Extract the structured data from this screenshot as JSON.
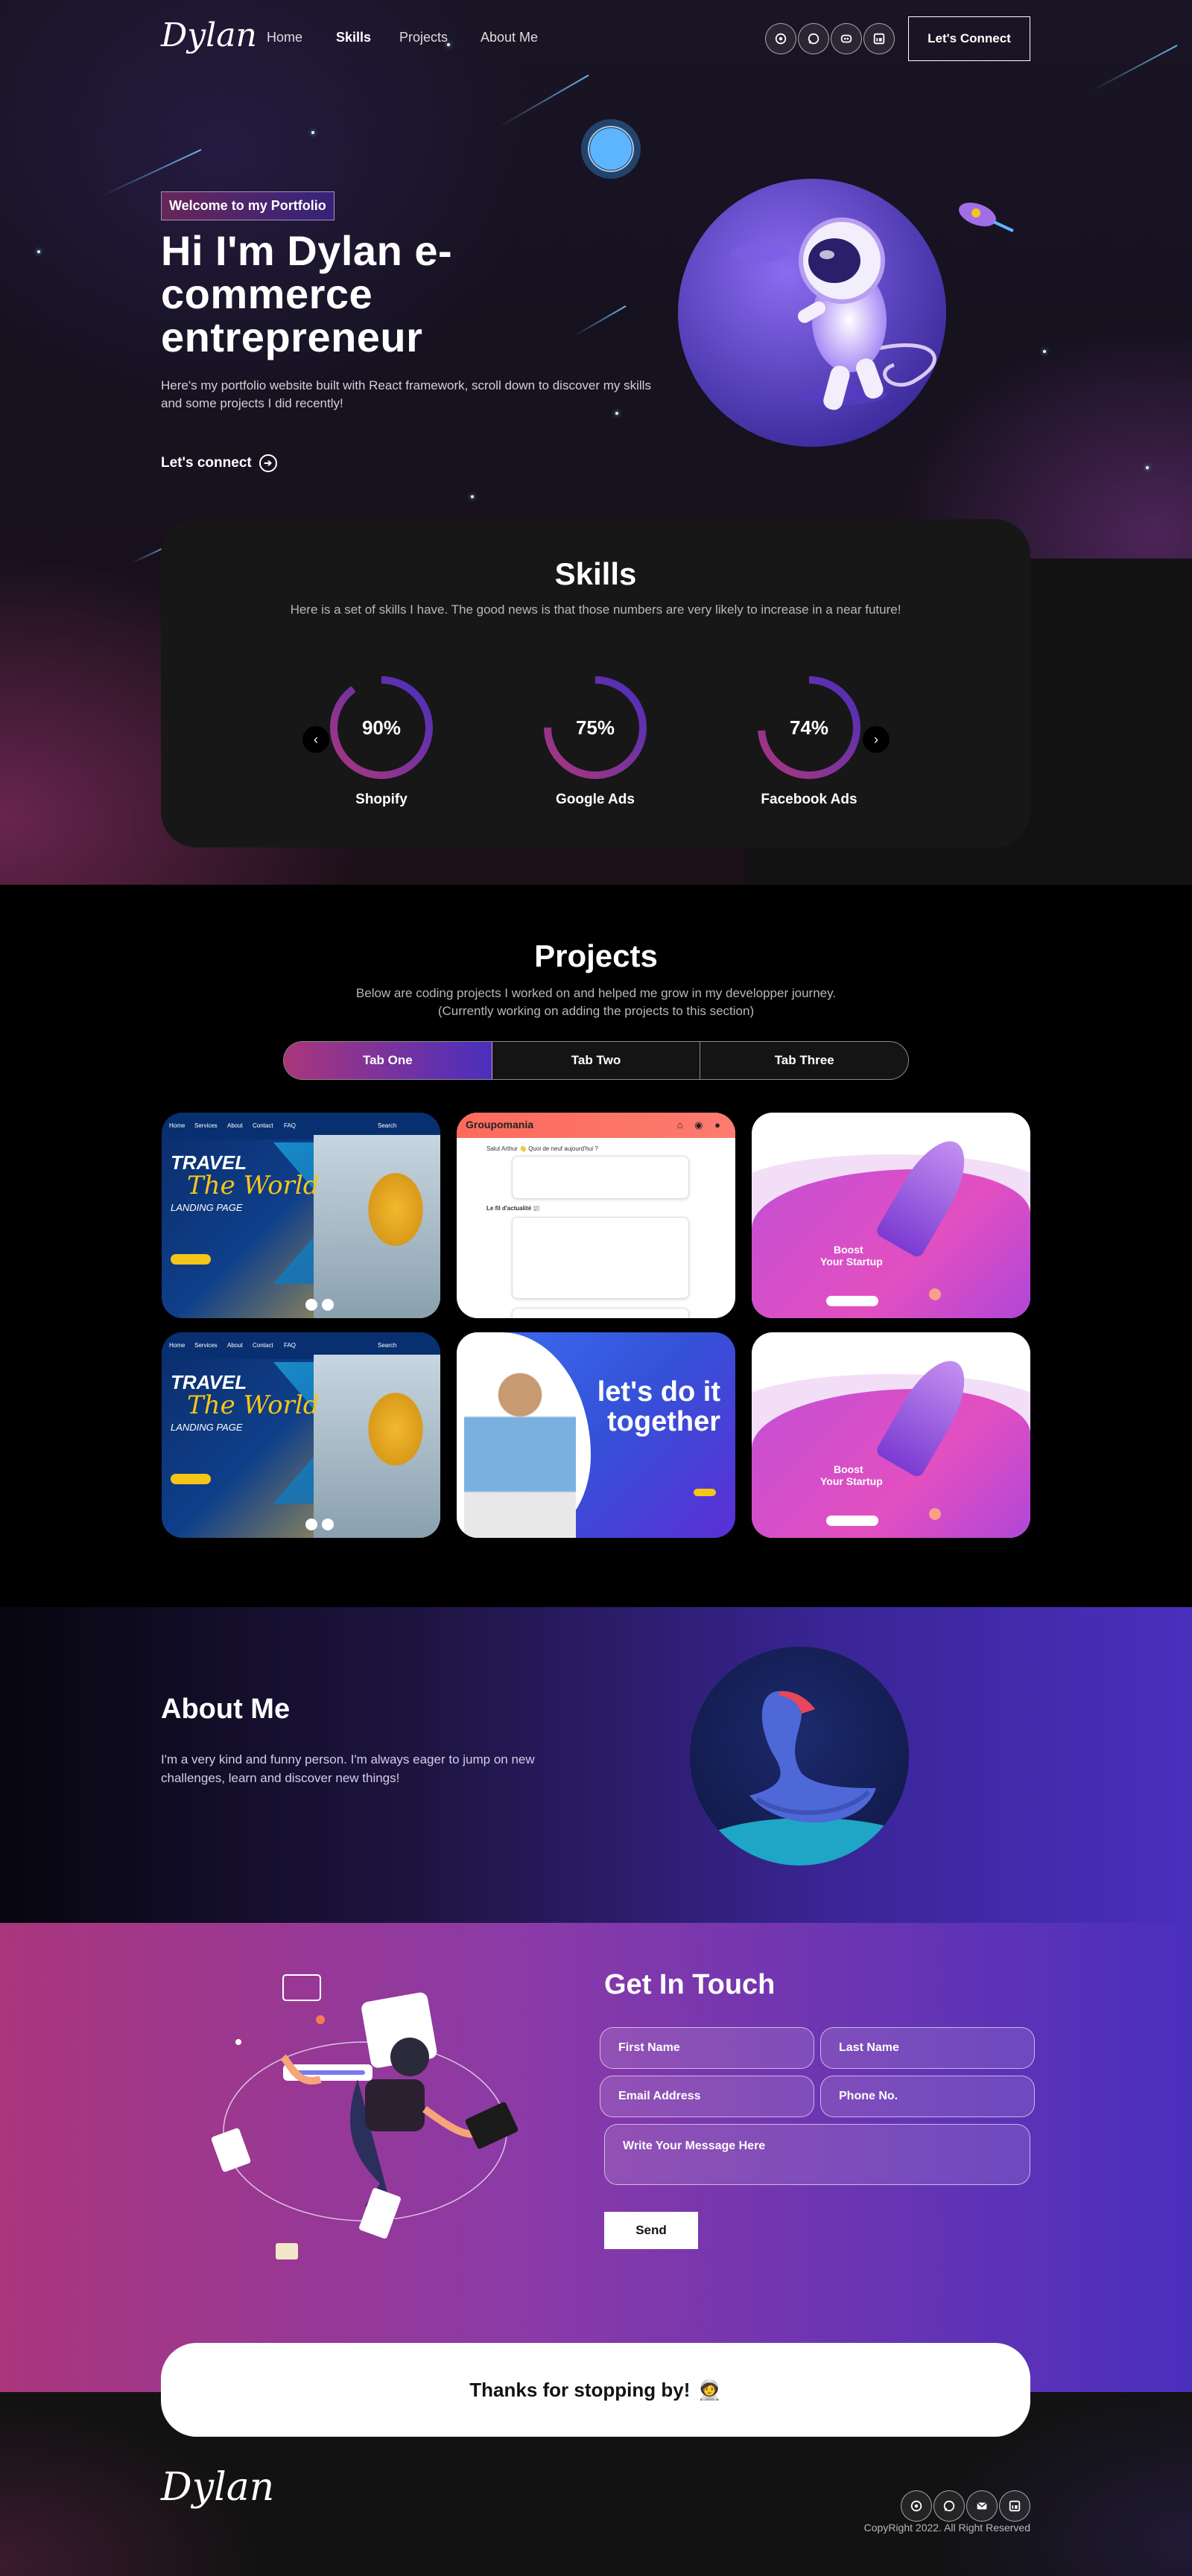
{
  "brand": {
    "logo": "Dylan"
  },
  "nav": {
    "links": [
      {
        "label": "Home"
      },
      {
        "label": "Skills"
      },
      {
        "label": "Projects"
      },
      {
        "label": "About Me"
      }
    ],
    "social_icons": [
      "github-icon",
      "whatsapp-icon",
      "discord-icon",
      "linkedin-icon"
    ],
    "connect_label": "Let's Connect"
  },
  "hero": {
    "tagline": "Welcome to my Portfolio",
    "title": "Hi I'm Dylan e-commerce entrepreneur",
    "description": "Here's my portfolio website built with React framework, scroll down to discover my skills and some projects I did recently!",
    "cta_label": "Let's connect"
  },
  "skills": {
    "title": "Skills",
    "subtitle": "Here is a set of skills I have. The good news is that those numbers are very likely to increase in a near future!",
    "items": [
      {
        "label": "Shopify",
        "percent_text": "90%",
        "percent": 90
      },
      {
        "label": "Google Ads",
        "percent_text": "75%",
        "percent": 75
      },
      {
        "label": "Facebook Ads",
        "percent_text": "74%",
        "percent": 74
      }
    ]
  },
  "projects": {
    "title": "Projects",
    "description": "Below are coding projects I worked on and helped me grow in my developper journey. (Currently working on adding the projects to this section)",
    "tabs": [
      {
        "label": "Tab One"
      },
      {
        "label": "Tab Two"
      },
      {
        "label": "Tab Three"
      }
    ],
    "cards": {
      "travel": {
        "nav": [
          "Home",
          "Services",
          "About",
          "Contact",
          "FAQ",
          "Search"
        ],
        "line1": "TRAVEL",
        "line2": "The World",
        "line3": "LANDING PAGE"
      },
      "groupomania": {
        "brand": "Groupomania",
        "prompt": "Salut Arthur 👋 Quoi de neuf aujourd'hui ?",
        "feed_title": "Le fil d'actualité 📰"
      },
      "startup": {
        "line1": "Boost",
        "line2": "Your Startup"
      },
      "letsdo": {
        "headline": "let's do it together"
      }
    }
  },
  "about": {
    "title": "About Me",
    "description": "I'm a very kind and funny person. I'm always eager to jump on new challenges, learn and discover new things!"
  },
  "contact": {
    "title": "Get In Touch",
    "fields": {
      "first_name": "First Name",
      "last_name": "Last Name",
      "email": "Email Address",
      "phone": "Phone No.",
      "message": "Write Your Message Here"
    },
    "send_label": "Send"
  },
  "newsletter": {
    "text": "Thanks for stopping by!",
    "emoji": "🧑‍🚀"
  },
  "footer": {
    "logo": "Dylan",
    "copyright": "CopyRight 2022. All Right Reserved"
  },
  "colors": {
    "accent_pink": "#aa367c",
    "accent_purple": "#4a2fbd",
    "background": "#121212"
  }
}
